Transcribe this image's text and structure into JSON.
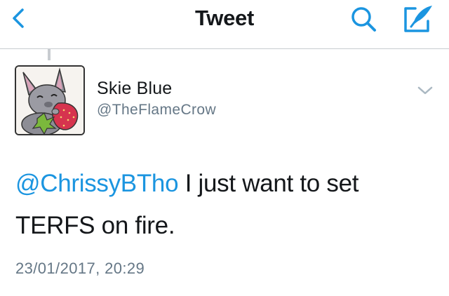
{
  "nav": {
    "title": "Tweet",
    "back_icon": "chevron-left-icon",
    "search_icon": "search-icon",
    "compose_icon": "compose-icon",
    "accent_color": "#1b95e0"
  },
  "tweet": {
    "author_name": "Skie Blue",
    "author_handle": "@TheFlameCrow",
    "avatar": "bat-holding-strawberry-avatar",
    "menu_icon": "chevron-down-icon",
    "mention": "@ChrissyBTho",
    "text_line1": " I just want to set",
    "text_line2": "TERFS on fire.",
    "timestamp": "23/01/2017, 20:29"
  }
}
